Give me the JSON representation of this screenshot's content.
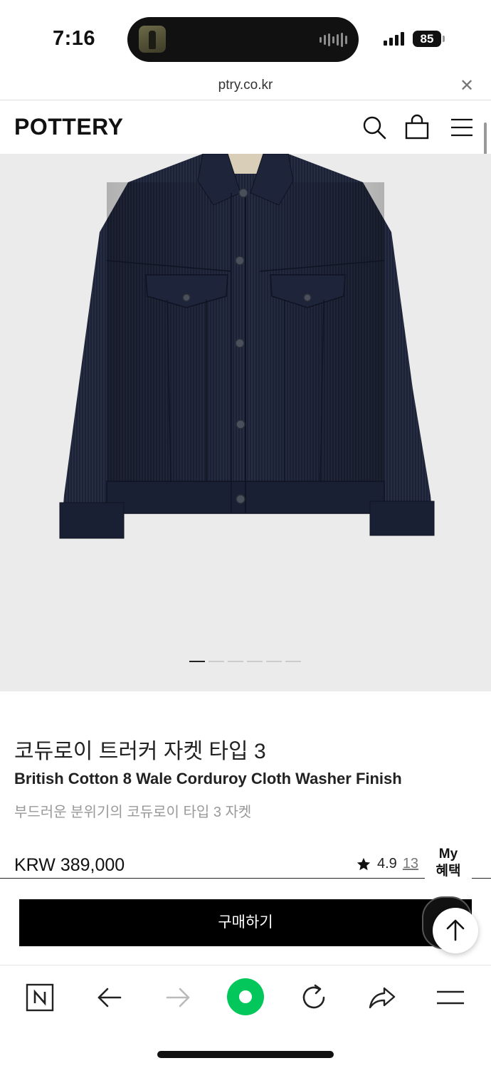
{
  "status_bar": {
    "time": "7:16",
    "battery": "85"
  },
  "browser": {
    "url": "ptry.co.kr"
  },
  "header": {
    "logo": "POTTERY",
    "icons": [
      "search-icon",
      "shopping-bag-icon",
      "menu-icon"
    ]
  },
  "gallery": {
    "image_count": 6,
    "active_index": 0
  },
  "product": {
    "title_ko": "코듀로이 트러커 자켓 타입 3",
    "title_en": "British Cotton 8 Wale Corduroy Cloth Washer Finish",
    "subtitle": "부드러운 분위기의 코듀로이 타입 3 자켓",
    "price": "KRW 389,000",
    "rating": "4.9",
    "review_count": "13"
  },
  "floating": {
    "my_benefit_line1": "My",
    "my_benefit_line2": "혜택"
  },
  "actions": {
    "buy_label": "구매하기"
  },
  "toolbar": {
    "icons": [
      "naver-icon",
      "back-arrow-icon",
      "forward-arrow-icon",
      "green-dot-icon",
      "reload-icon",
      "share-icon",
      "menu-icon"
    ]
  },
  "colors": {
    "accent_green": "#03c75a",
    "jacket_navy": "#1c2236",
    "hero_bg": "#ebebeb"
  }
}
